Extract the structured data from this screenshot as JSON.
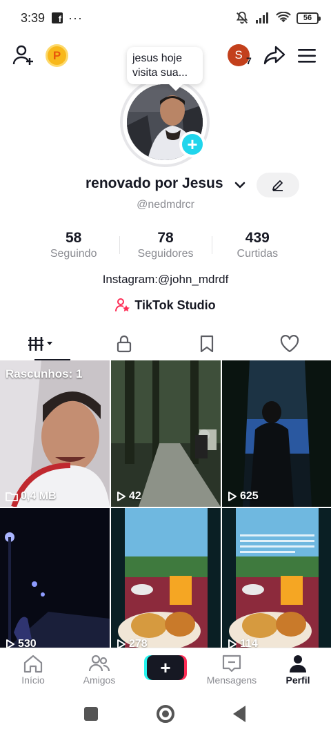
{
  "status_bar": {
    "time": "3:39",
    "dots": "···",
    "battery": "56",
    "icons": [
      "facebook-icon",
      "mute-icon",
      "signal-icon",
      "wifi-icon",
      "battery-icon"
    ]
  },
  "top_bar": {
    "coin_label": "P",
    "avatar_initial": "S",
    "avatar_badge": "7"
  },
  "tooltip": {
    "text": "jesus hoje visita sua..."
  },
  "profile": {
    "display_name": "renovado por Jesus",
    "username": "@nedmdrcr",
    "bio": "Instagram:@john_mdrdf",
    "studio_label": "TikTok Studio"
  },
  "stats": [
    {
      "value": "58",
      "label": "Seguindo"
    },
    {
      "value": "78",
      "label": "Seguidores"
    },
    {
      "value": "439",
      "label": "Curtidas"
    }
  ],
  "tabs": [
    {
      "icon": "grid-icon",
      "active": true
    },
    {
      "icon": "lock-icon",
      "active": false
    },
    {
      "icon": "bookmark-icon",
      "active": false
    },
    {
      "icon": "heart-icon",
      "active": false
    }
  ],
  "videos": [
    {
      "type": "draft",
      "label": "Rascunhos: 1",
      "meta": "0,4 MB"
    },
    {
      "type": "video",
      "views": "42"
    },
    {
      "type": "video",
      "views": "625"
    },
    {
      "type": "video",
      "views": "530"
    },
    {
      "type": "video",
      "views": "278"
    },
    {
      "type": "video",
      "views": "114"
    }
  ],
  "bottom_nav": {
    "home": "Início",
    "friends": "Amigos",
    "create": "+",
    "inbox": "Mensagens",
    "profile": "Perfil"
  },
  "colors": {
    "accent_cyan": "#20d5ec",
    "accent_pink": "#fe2c55",
    "coin": "#f8b81b",
    "avatar_red": "#c3401c"
  }
}
